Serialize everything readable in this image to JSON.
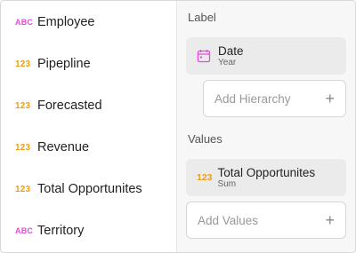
{
  "fields": [
    {
      "type": "ABC",
      "kind": "text",
      "name": "Employee"
    },
    {
      "type": "123",
      "kind": "num",
      "name": "Pipepline"
    },
    {
      "type": "123",
      "kind": "num",
      "name": "Forecasted"
    },
    {
      "type": "123",
      "kind": "num",
      "name": "Revenue"
    },
    {
      "type": "123",
      "kind": "num",
      "name": "Total Opportunites"
    },
    {
      "type": "ABC",
      "kind": "text",
      "name": "Territory"
    }
  ],
  "label_section": {
    "title": "Label",
    "chip": {
      "title": "Date",
      "subtitle": "Year",
      "icon": "calendar-icon"
    },
    "add_placeholder": "Add Hierarchy",
    "add_icon": "+"
  },
  "values_section": {
    "title": "Values",
    "chip": {
      "type": "123",
      "title": "Total Opportunites",
      "subtitle": "Sum"
    },
    "add_placeholder": "Add Values",
    "add_icon": "+"
  },
  "colors": {
    "text_type": "#e44be0",
    "number_type": "#f39c12",
    "calendar": "#e44be0"
  }
}
